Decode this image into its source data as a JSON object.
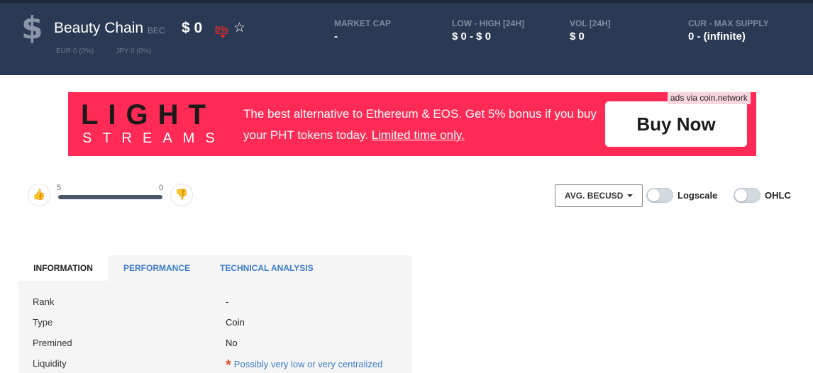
{
  "header": {
    "coin_icon": "dollar-sign-icon",
    "name": "Beauty Chain",
    "symbol": "BEC",
    "price": "$ 0",
    "change": "0%",
    "favorite_icon": "star-outline-icon",
    "fx": {
      "eur": "EUR 0 (0%)",
      "jpy": "JPY 0 (0%)"
    },
    "stats": [
      {
        "label": "MARKET CAP",
        "value": "-"
      },
      {
        "label": "LOW - HIGH [24H]",
        "value": "$ 0 - $ 0"
      },
      {
        "label": "VOL [24H]",
        "value": "$ 0"
      },
      {
        "label": "CUR - MAX SUPPLY",
        "value": "0 - (infinite)"
      }
    ],
    "colors": {
      "bar": "#2b3a54",
      "negative": "#e52b2b"
    }
  },
  "ad": {
    "logo_top": "LIGHT",
    "logo_bottom": "STREAMS",
    "text": "The best alternative to Ethereum & EOS. Get 5% bonus if you buy your PHT tokens today.",
    "link": "Limited time only.",
    "button": "Buy Now",
    "via": "ads via coin.network",
    "colors": {
      "background": "#ff2a55"
    }
  },
  "votes": {
    "up_icon": "thumbs-up-icon",
    "down_icon": "thumbs-down-icon",
    "up_count": "5",
    "down_count": "0",
    "up_fraction": 1.0
  },
  "controls": {
    "select_value": "AVG. BECUSD",
    "logscale_label": "Logscale",
    "ohlc_label": "OHLC",
    "logscale_on": false,
    "ohlc_on": false
  },
  "tabs": [
    {
      "label": "INFORMATION",
      "active": true
    },
    {
      "label": "PERFORMANCE",
      "active": false
    },
    {
      "label": "TECHNICAL ANALYSIS",
      "active": false
    }
  ],
  "info": {
    "rows": [
      {
        "key": "Rank",
        "value": "-"
      },
      {
        "key": "Type",
        "value": "Coin"
      },
      {
        "key": "Premined",
        "value": "No"
      },
      {
        "key": "Liquidity",
        "value": "Possibly very low or very centralized"
      }
    ],
    "warning_marker": "*"
  }
}
